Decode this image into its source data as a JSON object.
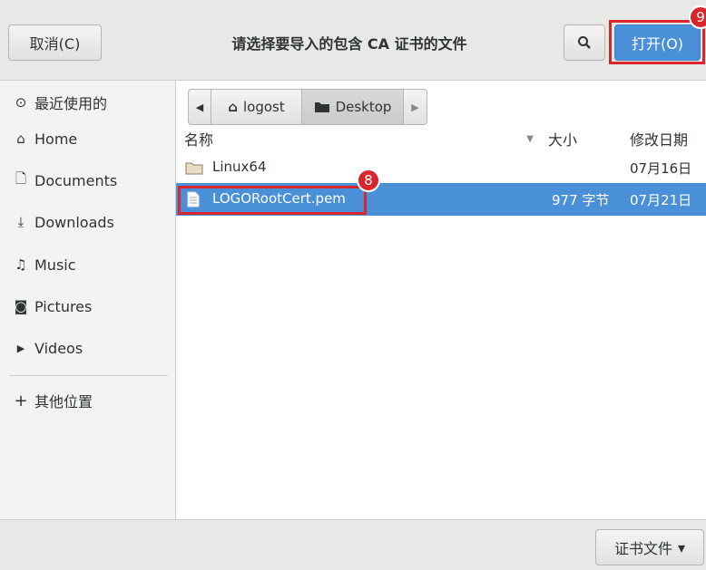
{
  "header": {
    "cancel_label": "取消(C)",
    "title": "请选择要导入的包含 CA 证书的文件",
    "search_icon": "search-icon",
    "open_label": "打开(O)",
    "open_badge": "9"
  },
  "sidebar": {
    "items": [
      {
        "icon": "clock-icon",
        "glyph": "⊙",
        "label": "最近使用的"
      },
      {
        "icon": "home-icon",
        "glyph": "⌂",
        "label": "Home"
      },
      {
        "icon": "document-icon",
        "glyph": "🗋",
        "label": "Documents"
      },
      {
        "icon": "download-icon",
        "glyph": "⤓",
        "label": "Downloads"
      },
      {
        "icon": "music-icon",
        "glyph": "♫",
        "label": "Music"
      },
      {
        "icon": "camera-icon",
        "glyph": "◙",
        "label": "Pictures"
      },
      {
        "icon": "video-icon",
        "glyph": "▶",
        "label": "Videos"
      }
    ],
    "other_locations": {
      "glyph": "+",
      "label": "其他位置"
    }
  },
  "pathbar": {
    "back_glyph": "◀",
    "home_glyph": "⌂",
    "home_label": "logost",
    "folder_label": "Desktop",
    "forward_glyph": "▶"
  },
  "columns": {
    "name": "名称",
    "sort_glyph": "▼",
    "size": "大小",
    "modified": "修改日期"
  },
  "files": [
    {
      "name": "Linux64",
      "size": "",
      "modified": "07月16日",
      "type": "folder",
      "selected": false
    },
    {
      "name": "LOGORootCert.pem",
      "size": "977 字节",
      "modified": "07月21日",
      "type": "file",
      "selected": true,
      "badge": "8"
    }
  ],
  "footer": {
    "filter_label": "证书文件",
    "filter_arrow": "▾"
  },
  "colors": {
    "accent": "#4a90d9",
    "annotation": "#d9262c"
  }
}
